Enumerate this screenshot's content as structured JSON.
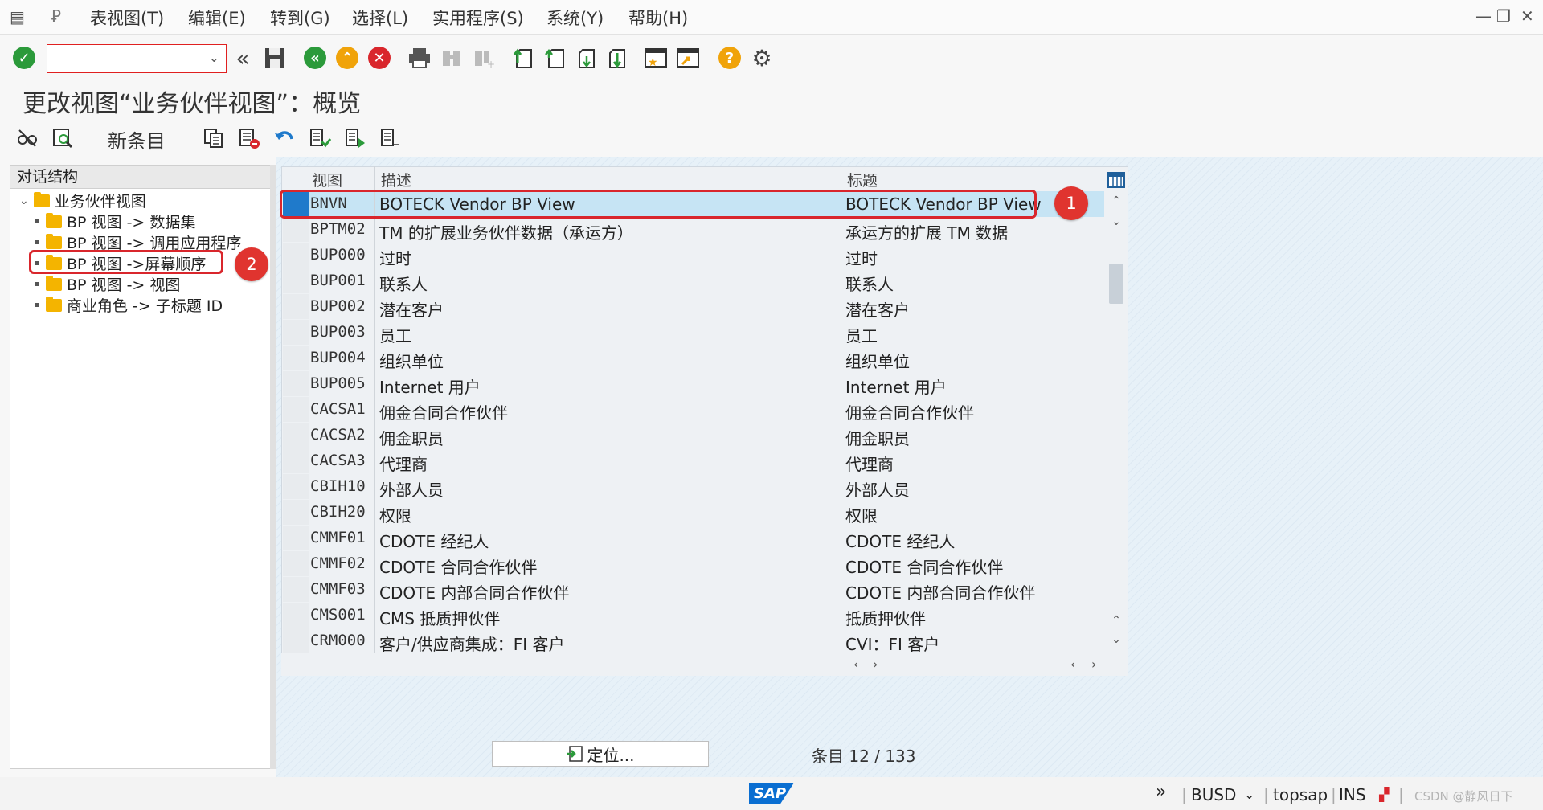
{
  "menubar": {
    "items": [
      "表视图(T)",
      "编辑(E)",
      "转到(G)",
      "选择(L)",
      "实用程序(S)",
      "系统(Y)",
      "帮助(H)"
    ]
  },
  "toolbar": {
    "command_field_value": "",
    "icons": [
      "check-icon",
      "back-double-icon",
      "save-icon",
      "back-icon",
      "exit-icon",
      "cancel-icon",
      "print-icon",
      "find-icon",
      "find-next-icon",
      "first-page-icon",
      "prev-page-icon",
      "next-page-icon",
      "last-page-icon",
      "new-session-icon",
      "shortcut-icon",
      "help-icon",
      "settings-icon"
    ]
  },
  "page_title": "更改视图“业务伙伴视图”：概览",
  "app_toolbar": {
    "new_entries_label": "新条目"
  },
  "tree": {
    "header": "对话结构",
    "root": "业务伙伴视图",
    "children": [
      "BP 视图 -> 数据集",
      "BP 视图 -> 调用应用程序",
      "BP 视图 ->屏幕顺序",
      "BP 视图 -> 视图",
      "商业角色 -> 子标题 ID"
    ]
  },
  "table": {
    "columns": [
      "视图",
      "描述",
      "标题"
    ],
    "rows": [
      {
        "view": "BNVN",
        "desc": "BOTECK Vendor BP View",
        "title": "BOTECK Vendor BP View",
        "selected": true
      },
      {
        "view": "BPTM02",
        "desc": "TM 的扩展业务伙伴数据（承运方）",
        "title": "承运方的扩展 TM 数据"
      },
      {
        "view": "BUP000",
        "desc": "过时",
        "title": "过时"
      },
      {
        "view": "BUP001",
        "desc": "联系人",
        "title": "联系人"
      },
      {
        "view": "BUP002",
        "desc": "潜在客户",
        "title": "潜在客户"
      },
      {
        "view": "BUP003",
        "desc": "员工",
        "title": "员工"
      },
      {
        "view": "BUP004",
        "desc": "组织单位",
        "title": "组织单位"
      },
      {
        "view": "BUP005",
        "desc": "Internet 用户",
        "title": "Internet 用户"
      },
      {
        "view": "CACSA1",
        "desc": "佣金合同合作伙伴",
        "title": "佣金合同合作伙伴"
      },
      {
        "view": "CACSA2",
        "desc": "佣金职员",
        "title": "佣金职员"
      },
      {
        "view": "CACSA3",
        "desc": "代理商",
        "title": "代理商"
      },
      {
        "view": "CBIH10",
        "desc": "外部人员",
        "title": "外部人员"
      },
      {
        "view": "CBIH20",
        "desc": "权限",
        "title": "权限"
      },
      {
        "view": "CMMF01",
        "desc": "CDOTE 经纪人",
        "title": "CDOTE 经纪人"
      },
      {
        "view": "CMMF02",
        "desc": "CDOTE 合同合作伙伴",
        "title": "CDOTE 合同合作伙伴"
      },
      {
        "view": "CMMF03",
        "desc": "CDOTE 内部合同合作伙伴",
        "title": "CDOTE 内部合同合作伙伴"
      },
      {
        "view": "CMS001",
        "desc": "CMS 抵质押伙伴",
        "title": "抵质押伙伴"
      },
      {
        "view": "CRM000",
        "desc": "客户/供应商集成：FI 客户",
        "title": "CVI：FI 客户"
      }
    ]
  },
  "annotations": [
    "1",
    "2"
  ],
  "position_button_label": "定位...",
  "entry_count": "条目 12 / 133",
  "statusbar": {
    "system": "BUSD",
    "server": "topsap",
    "mode": "INS",
    "watermark": "CSDN @静风日下"
  },
  "colors": {
    "selected_row": "#c6e4f4",
    "row_selector_selected": "#1f7acb",
    "annotation_red": "#e0342f",
    "folder": "#f4b400",
    "sap_blue": "#0a6ed1"
  }
}
